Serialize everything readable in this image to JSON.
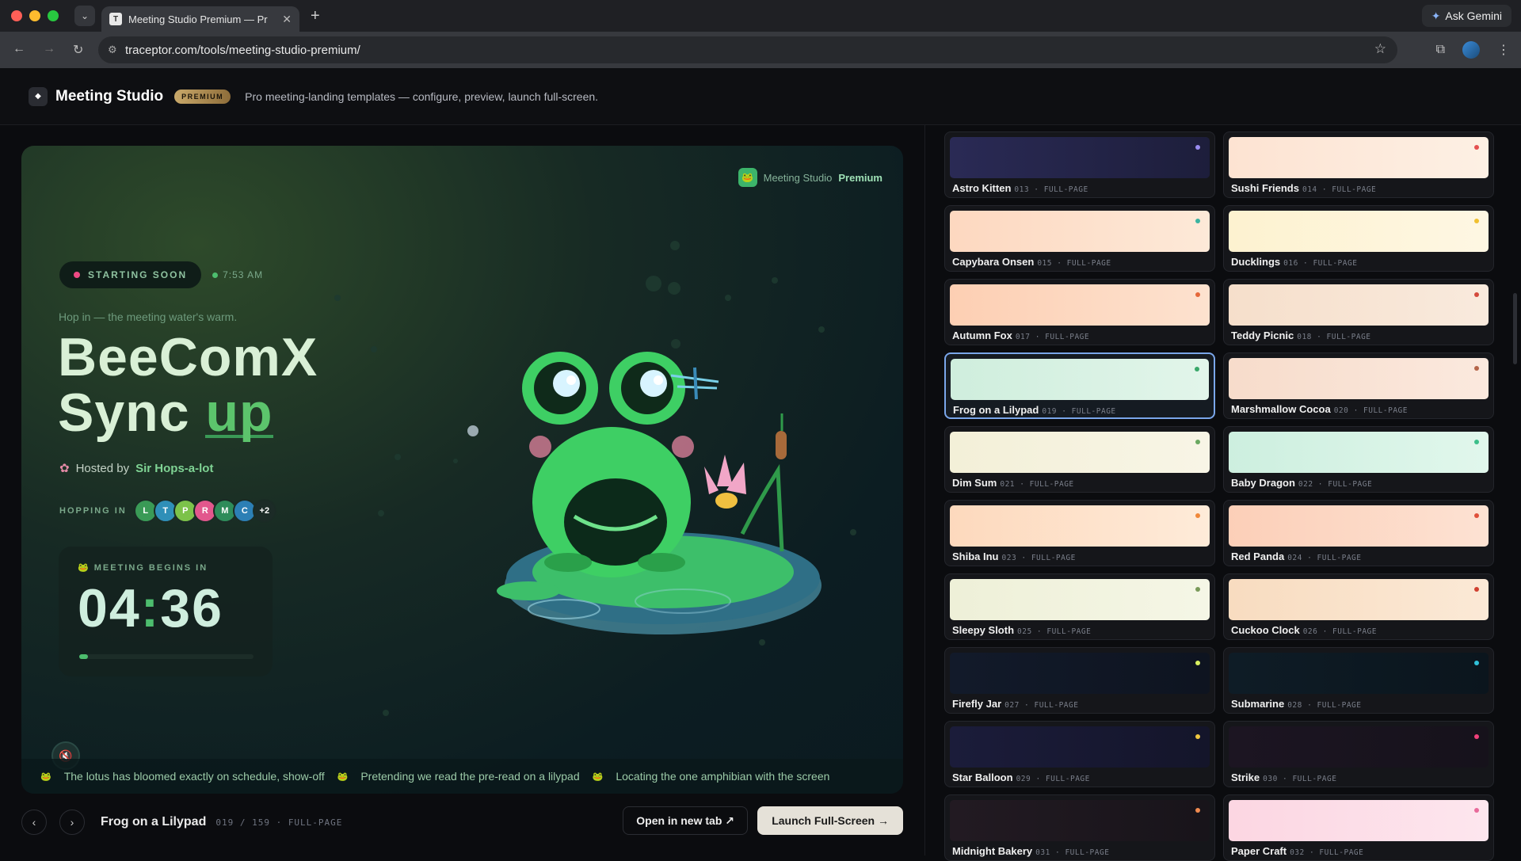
{
  "browser": {
    "tab_title": "Meeting Studio Premium — Pr",
    "tab_favicon": "T",
    "url": "traceptor.com/tools/meeting-studio-premium/",
    "ask_gemini": "Ask Gemini"
  },
  "app": {
    "logo": "◆",
    "name": "Meeting Studio",
    "badge": "PREMIUM",
    "tagline": "Pro meeting-landing templates — configure, preview, launch full-screen."
  },
  "preview": {
    "brand_prefix": "Meeting Studio",
    "brand_suffix": "Premium",
    "status": "STARTING SOON",
    "time": "7:53 AM",
    "tagline": "Hop in — the meeting water's warm.",
    "title_line1": "BeeComX",
    "title_line2a": "Sync",
    "title_line2b": "up",
    "host_label": "Hosted by",
    "host_name": "Sir Hops-a-lot",
    "hopping_label": "HOPPING IN",
    "attendees": [
      {
        "initial": "L",
        "color": "#3a9a56"
      },
      {
        "initial": "T",
        "color": "#2f8fb8"
      },
      {
        "initial": "P",
        "color": "#7cc24a"
      },
      {
        "initial": "R",
        "color": "#e2578d"
      },
      {
        "initial": "M",
        "color": "#2e8c5a"
      },
      {
        "initial": "C",
        "color": "#2c7fb5"
      },
      {
        "initial": "+2",
        "color": "#1c2b27"
      }
    ],
    "countdown_label": "MEETING BEGINS IN",
    "countdown_min": "04",
    "countdown_sep": ":",
    "countdown_sec": "36",
    "countdown_progress": 0.05,
    "ticker": [
      "The lotus has bloomed exactly on schedule, show-off",
      "Pretending we read the pre-read on a lilypad",
      "Locating the one amphibian with the screen"
    ]
  },
  "footer": {
    "prev": "‹",
    "next": "›",
    "name": "Frog on a Lilypad",
    "meta": "019 / 159 · FULL-PAGE",
    "open_tab": "Open in new tab ↗",
    "launch": "Launch Full-Screen →"
  },
  "templates": [
    {
      "name": "Astro Kitten",
      "meta": "013 · FULL-PAGE",
      "bg": "linear-gradient(90deg,#2a2a55,#1d1e3b)",
      "dot": "#9a8cf0"
    },
    {
      "name": "Sushi Friends",
      "meta": "014 · FULL-PAGE",
      "bg": "linear-gradient(90deg,#fde3d2,#fdf0e4)",
      "dot": "#e45050"
    },
    {
      "name": "Capybara Onsen",
      "meta": "015 · FULL-PAGE",
      "bg": "linear-gradient(90deg,#fdd8c0,#fde9d8)",
      "dot": "#3bb3a0"
    },
    {
      "name": "Ducklings",
      "meta": "016 · FULL-PAGE",
      "bg": "linear-gradient(90deg,#fdf2d0,#fef7e3)",
      "dot": "#f0c030"
    },
    {
      "name": "Autumn Fox",
      "meta": "017 · FULL-PAGE",
      "bg": "linear-gradient(90deg,#fdcfb3,#fde2cf)",
      "dot": "#e5683a"
    },
    {
      "name": "Teddy Picnic",
      "meta": "018 · FULL-PAGE",
      "bg": "linear-gradient(90deg,#f6dfcb,#f9eadd)",
      "dot": "#d44a3c"
    },
    {
      "name": "Frog on a Lilypad",
      "meta": "019 · FULL-PAGE",
      "bg": "linear-gradient(90deg,#cfeedd,#e2f5ea)",
      "dot": "#3aa86a",
      "selected": true
    },
    {
      "name": "Marshmallow Cocoa",
      "meta": "020 · FULL-PAGE",
      "bg": "linear-gradient(90deg,#f7dccb,#fbe9de)",
      "dot": "#b5654a"
    },
    {
      "name": "Dim Sum",
      "meta": "021 · FULL-PAGE",
      "bg": "linear-gradient(90deg,#f3f0d8,#f8f5e6)",
      "dot": "#6aa860"
    },
    {
      "name": "Baby Dragon",
      "meta": "022 · FULL-PAGE",
      "bg": "linear-gradient(90deg,#cdefdf,#e1f7ec)",
      "dot": "#3cbf8a"
    },
    {
      "name": "Shiba Inu",
      "meta": "023 · FULL-PAGE",
      "bg": "linear-gradient(90deg,#fdd9bd,#feebd9)",
      "dot": "#f0883a"
    },
    {
      "name": "Red Panda",
      "meta": "024 · FULL-PAGE",
      "bg": "linear-gradient(90deg,#fccfb8,#fde2d3)",
      "dot": "#e0503a"
    },
    {
      "name": "Sleepy Sloth",
      "meta": "025 · FULL-PAGE",
      "bg": "linear-gradient(90deg,#eef0d8,#f5f6e6)",
      "dot": "#7a9a5a"
    },
    {
      "name": "Cuckoo Clock",
      "meta": "026 · FULL-PAGE",
      "bg": "linear-gradient(90deg,#f8dcc0,#fbe9d6)",
      "dot": "#d04030"
    },
    {
      "name": "Firefly Jar",
      "meta": "027 · FULL-PAGE",
      "bg": "linear-gradient(90deg,#121a2a,#0e1420)",
      "dot": "#d8f060"
    },
    {
      "name": "Submarine",
      "meta": "028 · FULL-PAGE",
      "bg": "linear-gradient(90deg,#0e1c26,#0b151d)",
      "dot": "#30c0d8"
    },
    {
      "name": "Star Balloon",
      "meta": "029 · FULL-PAGE",
      "bg": "linear-gradient(90deg,#1b1c3a,#14152a)",
      "dot": "#f0c840"
    },
    {
      "name": "Strike",
      "meta": "030 · FULL-PAGE",
      "bg": "linear-gradient(90deg,#1c1522,#16121b)",
      "dot": "#f0407a"
    },
    {
      "name": "Midnight Bakery",
      "meta": "031 · FULL-PAGE",
      "bg": "linear-gradient(90deg,#221a22,#18141a)",
      "dot": "#f08a50"
    },
    {
      "name": "Paper Craft",
      "meta": "032 · FULL-PAGE",
      "bg": "linear-gradient(90deg,#fcd6e2,#fde6ee)",
      "dot": "#e86a9a"
    }
  ]
}
